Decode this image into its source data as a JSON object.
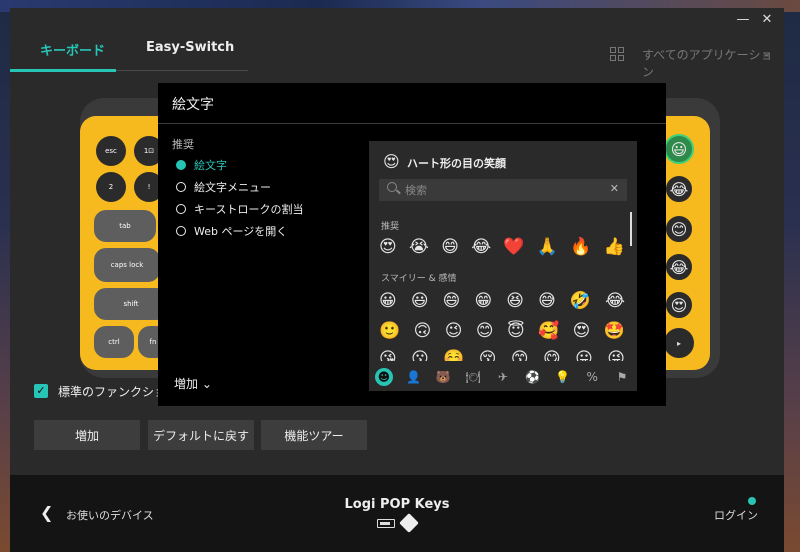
{
  "window": {
    "minimize": "—",
    "close": "✕"
  },
  "tabs": [
    {
      "label": "キーボード",
      "active": true
    },
    {
      "label": "Easy-Switch",
      "active": false
    }
  ],
  "apps_selector": {
    "label": "すべてのアプリケーション",
    "chevron": "⌄"
  },
  "keyboard": {
    "keys": {
      "esc": "esc",
      "f1": "1⊡",
      "f2": "2",
      "bang": "!",
      "tab": "tab",
      "caps": "caps lock",
      "shift": "shift",
      "ctrl": "ctrl",
      "fn": "fn"
    },
    "emoji_keys": [
      "😃",
      "😂",
      "😊",
      "😂",
      "😍"
    ],
    "play_key": "▸"
  },
  "standard_fn": {
    "label": "標準のファンクションキー",
    "checked": true,
    "check": "✓"
  },
  "buttons": {
    "add": "増加",
    "reset": "デフォルトに戻す",
    "tour": "機能ツアー"
  },
  "footer": {
    "back": "お使いのデバイス",
    "device": "Logi POP Keys",
    "login": "ログイン"
  },
  "modal": {
    "title": "絵文字",
    "section": "推奨",
    "options": [
      {
        "label": "絵文字",
        "selected": true
      },
      {
        "label": "絵文字メニュー",
        "selected": false
      },
      {
        "label": "キーストロークの割当",
        "selected": false
      },
      {
        "label": "Web ページを開く",
        "selected": false
      }
    ],
    "add_menu": "増加",
    "add_chevron": "⌄"
  },
  "emoji_panel": {
    "selected_emoji": "😍",
    "selected_name": "ハート形の目の笑顔",
    "search_placeholder": "検索",
    "search_clear": "✕",
    "recommended_label": "推奨",
    "recommended": [
      "😍",
      "😭",
      "😄",
      "😂",
      "❤️",
      "🙏",
      "🔥",
      "👍"
    ],
    "smileys_label": "スマイリー & 感情",
    "smileys_row1": [
      "😀",
      "😃",
      "😄",
      "😁",
      "😆",
      "😅",
      "🤣",
      "😂"
    ],
    "smileys_row2": [
      "🙂",
      "🙃",
      "😉",
      "😊",
      "😇",
      "🥰",
      "😍",
      "🤩"
    ],
    "smileys_row3": [
      "😘",
      "😗",
      "☺️",
      "😚",
      "😙",
      "😋",
      "😛",
      "😜"
    ],
    "categories": [
      "☻",
      "👤",
      "🐻",
      "🍽",
      "✈",
      "⚽",
      "💡",
      "%",
      "⚑"
    ]
  },
  "colors": {
    "accent": "#27c5b6",
    "keyboard_yellow": "#f6b91e"
  }
}
